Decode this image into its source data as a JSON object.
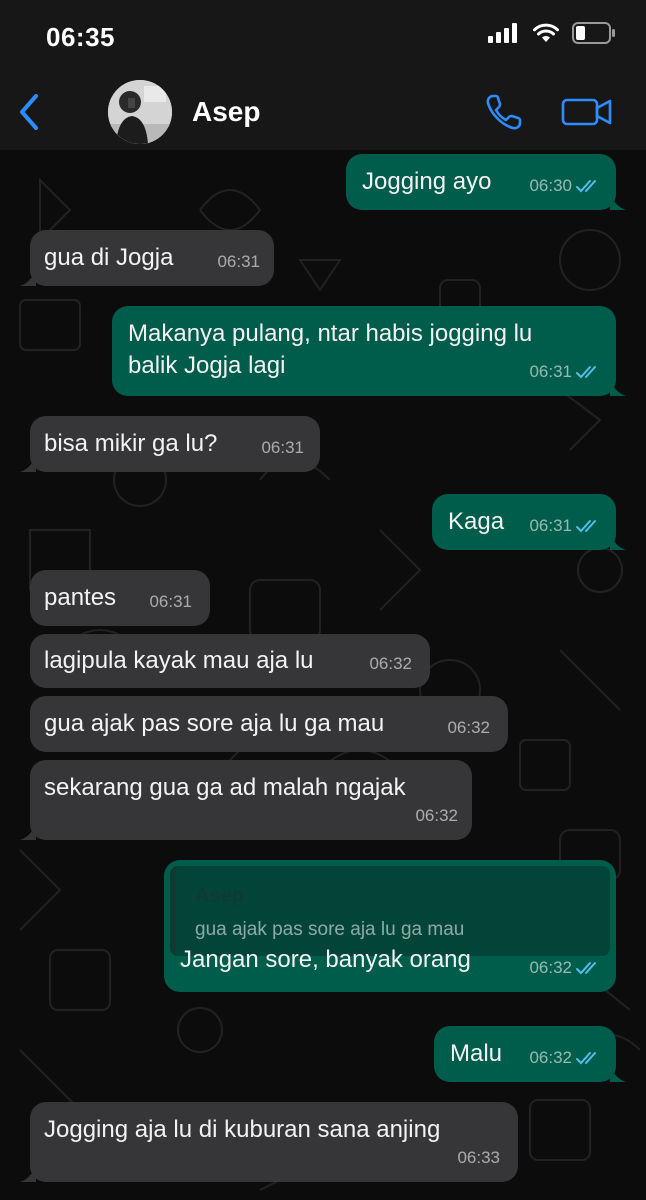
{
  "status_bar": {
    "time": "06:35"
  },
  "header": {
    "contact_name": "Asep"
  },
  "colors": {
    "outgoing_bubble": "#005c4b",
    "incoming_bubble": "#363638",
    "accent": "#2d8cff",
    "read_ticks": "#53bdeb"
  },
  "messages": [
    {
      "direction": "out",
      "text": "Jogging ayo",
      "time": "06:30",
      "read": true
    },
    {
      "direction": "in",
      "text": "gua di Jogja",
      "time": "06:31"
    },
    {
      "direction": "out",
      "lines": [
        "Makanya pulang, ntar habis jogging lu",
        "balik Jogja lagi"
      ],
      "time": "06:31",
      "read": true
    },
    {
      "direction": "in",
      "text": "bisa mikir ga lu?",
      "time": "06:31"
    },
    {
      "direction": "out",
      "text": "Kaga",
      "time": "06:31",
      "read": true
    },
    {
      "direction": "in",
      "text": "pantes",
      "time": "06:31"
    },
    {
      "direction": "in",
      "text": "lagipula kayak mau aja lu",
      "time": "06:32"
    },
    {
      "direction": "in",
      "text": "gua ajak pas sore aja lu ga mau",
      "time": "06:32"
    },
    {
      "direction": "in",
      "text": "sekarang gua ga ad malah ngajak",
      "time": "06:32"
    },
    {
      "direction": "out",
      "quote": {
        "name": "Asep",
        "text": "gua ajak pas sore aja lu ga mau"
      },
      "text": "Jangan sore, banyak orang",
      "time": "06:32",
      "read": true
    },
    {
      "direction": "out",
      "text": "Malu",
      "time": "06:32",
      "read": true
    },
    {
      "direction": "in",
      "text": "Jogging aja lu di kuburan sana anjing",
      "time": "06:33"
    }
  ]
}
